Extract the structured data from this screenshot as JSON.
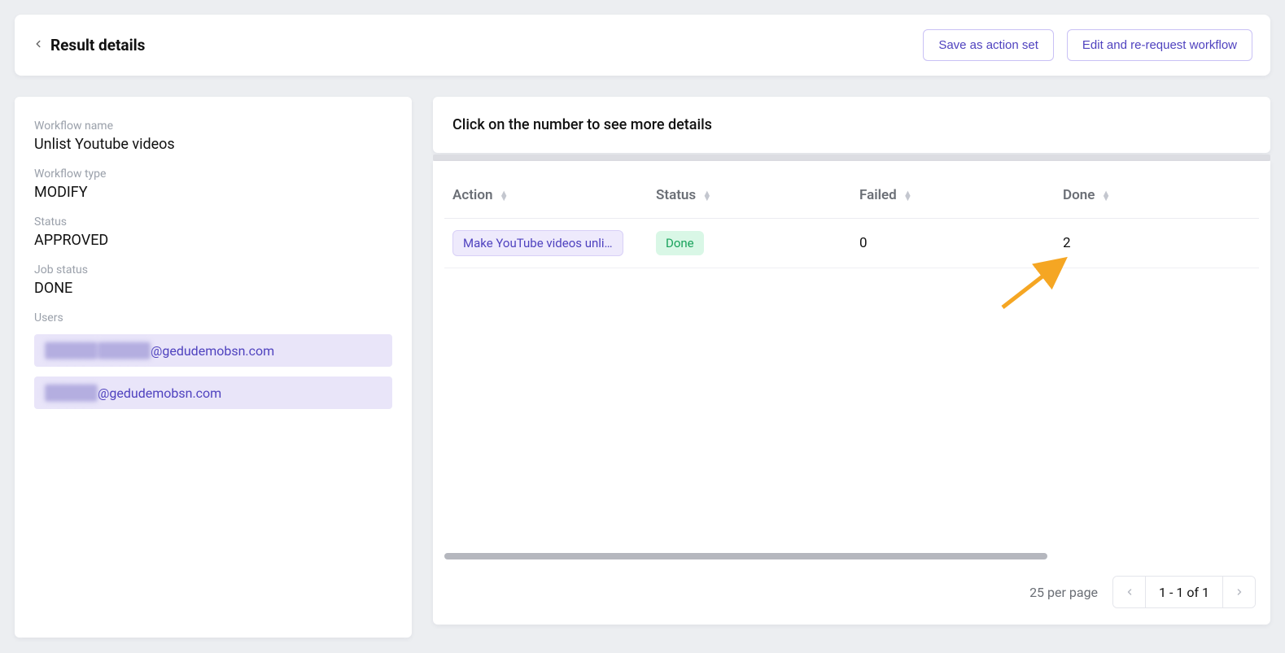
{
  "header": {
    "title": "Result details",
    "save_action_set": "Save as action set",
    "edit_rerequest": "Edit and re-request workflow"
  },
  "details": {
    "workflow_name_label": "Workflow name",
    "workflow_name": "Unlist Youtube videos",
    "workflow_type_label": "Workflow type",
    "workflow_type": "MODIFY",
    "status_label": "Status",
    "status": "APPROVED",
    "job_status_label": "Job status",
    "job_status": "DONE",
    "users_label": "Users",
    "users": [
      {
        "obscured": "██████ ██████",
        "domain": "@gedudemobsn.com"
      },
      {
        "obscured": "██████",
        "domain": "@gedudemobsn.com"
      }
    ]
  },
  "main": {
    "hint": "Click on the number to see more details",
    "columns": {
      "action": "Action",
      "status": "Status",
      "failed": "Failed",
      "done": "Done"
    },
    "rows": [
      {
        "action": "Make YouTube videos unli…",
        "status": "Done",
        "failed": "0",
        "done": "2"
      }
    ],
    "per_page": "25 per page",
    "range": "1 - 1 of 1"
  }
}
